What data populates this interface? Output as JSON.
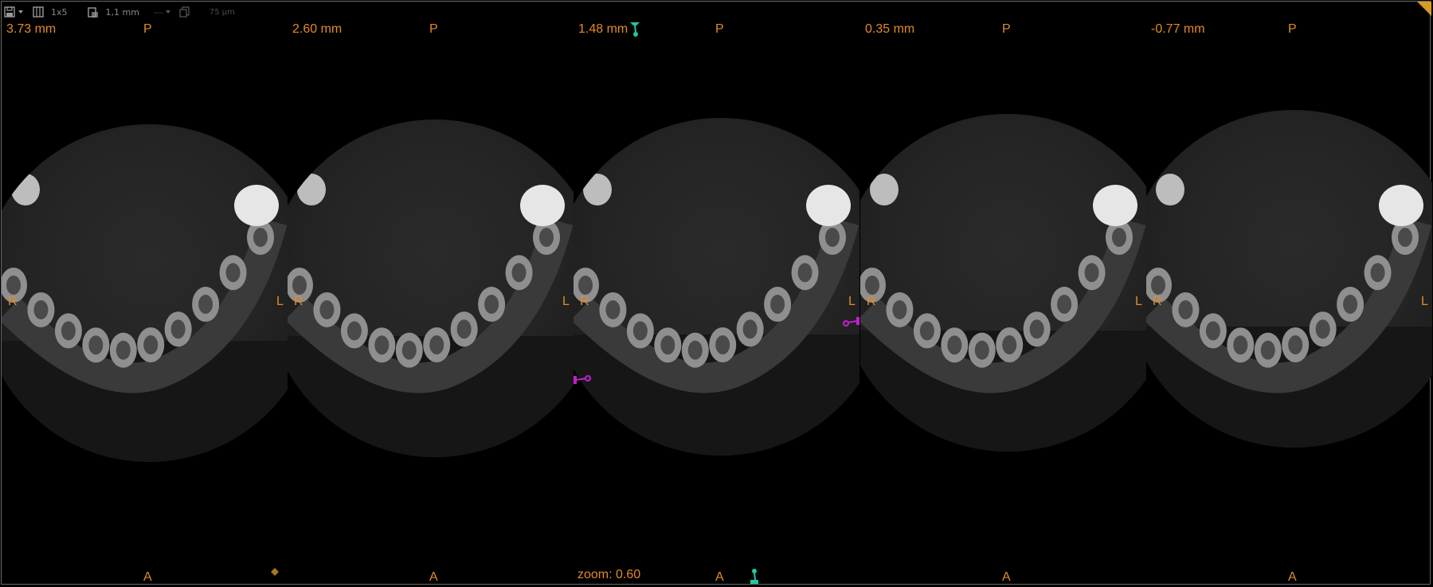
{
  "toolbar": {
    "layout": "1x5",
    "thickness": "1,1 mm",
    "separator": "---",
    "voxel": "75 µm",
    "icons": [
      "save-icon",
      "grid-layout-icon",
      "slab-thickness-icon",
      "dropdown-icon",
      "copy-icon"
    ]
  },
  "panels": [
    {
      "depth": "3.73 mm",
      "posterior": "P",
      "anterior": "A",
      "right": "R",
      "left": "L"
    },
    {
      "depth": "2.60 mm",
      "posterior": "P",
      "anterior": "A",
      "right": "R",
      "left": "L"
    },
    {
      "depth": "1.48 mm",
      "posterior": "P",
      "anterior": "A",
      "right": "R",
      "left": "L"
    },
    {
      "depth": "0.35 mm",
      "posterior": "P",
      "anterior": "A",
      "right": "R",
      "left": "L"
    },
    {
      "depth": "-0.77 mm",
      "posterior": "P",
      "anterior": "A",
      "right": "R",
      "left": "L"
    }
  ],
  "zoom": "zoom: 0.60",
  "colors": {
    "label": "#e08a2c",
    "corner": "#d89a22",
    "marker_green": "#21c7a0",
    "marker_magenta": "#c21fd0"
  }
}
